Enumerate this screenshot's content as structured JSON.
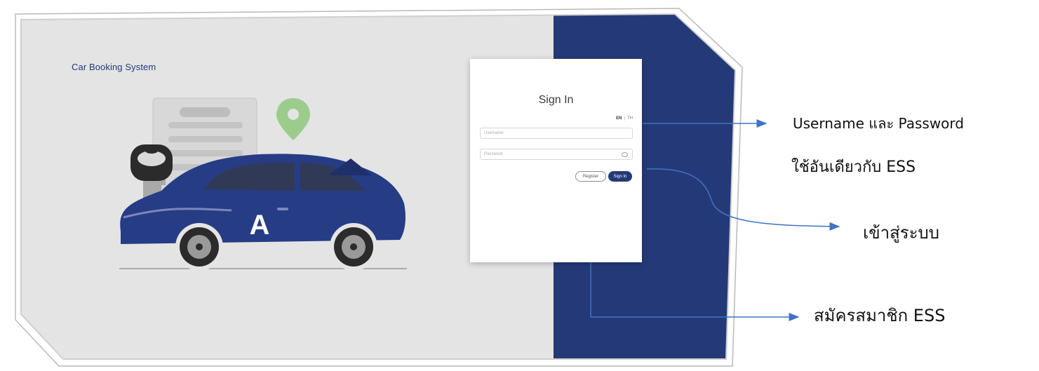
{
  "app": {
    "title": "Car Booking System"
  },
  "signin": {
    "title": "Sign In",
    "lang_en": "EN",
    "lang_sep": "|",
    "lang_th": "TH",
    "username_placeholder": "Username",
    "password_placeholder": "Password",
    "register_label": "Register",
    "signin_label": "Sign In"
  },
  "illustration": {
    "car_badge": "A"
  },
  "annotations": {
    "credentials_line1": "Username และ Password",
    "credentials_line2": "ใช้อันเดียวกับ ESS",
    "signin_note": "เข้าสู่ระบบ",
    "register_note": "สมัครสมาชิก ESS"
  },
  "colors": {
    "navy": "#243a78",
    "gray_bg": "#e4e4e4",
    "arrow": "#3f73c4",
    "pin_green": "#9ccc8c"
  }
}
